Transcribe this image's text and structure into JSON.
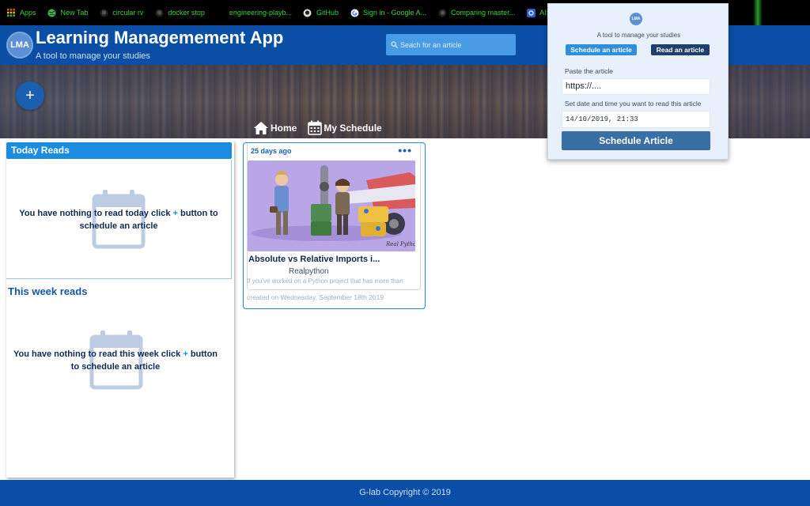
{
  "bookmarks": [
    {
      "label": "Apps",
      "icon": "apps-grid-icon"
    },
    {
      "label": "New Tab",
      "icon": "globe-icon"
    },
    {
      "label": "circular rv",
      "icon": "github-icon"
    },
    {
      "label": "docker stop",
      "icon": "github-icon"
    },
    {
      "label": "engineering-playb...",
      "icon": "blank-icon"
    },
    {
      "label": "GitHub",
      "icon": "github-icon"
    },
    {
      "label": "Sign in - Google A...",
      "icon": "google-icon"
    },
    {
      "label": "Comparing master...",
      "icon": "github-icon"
    },
    {
      "label": "AIS -",
      "icon": "settings-icon"
    }
  ],
  "header": {
    "logo": "LMA",
    "title": "Learning Managemement App",
    "subtitle": "A tool to manage your studies",
    "search_placeholder": "Seach for an article"
  },
  "hero": {
    "add_button": "+"
  },
  "nav": {
    "home": "Home",
    "schedule": "My Schedule"
  },
  "today": {
    "heading": "Today Reads",
    "message_before": "You have nothing to read today click",
    "plus": "+",
    "message_after": "button to schedule an article"
  },
  "week": {
    "heading": "This week reads",
    "message_before": "You have nothing to read this week click",
    "plus": "+",
    "message_after": "button to schedule an article"
  },
  "article": {
    "time_ago": "25 days ago",
    "more": "•••",
    "title": "Absolute vs Relative Imports i...",
    "source": "Realpython",
    "description": "If you've worked on a Python project that has more than",
    "created": "created on Wednesday, September 18th 2019"
  },
  "popup": {
    "logo": "LMA",
    "subtitle": "A tool to manage your studies",
    "tab_schedule": "Schedule an article",
    "tab_read": "Read an article",
    "paste_label": "Paste the article",
    "url_value": "https://....",
    "datetime_label": "Set date and time you want to read this article",
    "datetime_value": "14/10/2019, 21:33",
    "submit": "Schedule Article"
  },
  "footer": {
    "text": "G-lab Copyright © 2019"
  },
  "colors": {
    "primary": "#0a4ea5",
    "accent": "#1a8de0",
    "bookmark_text": "#35d23b"
  }
}
